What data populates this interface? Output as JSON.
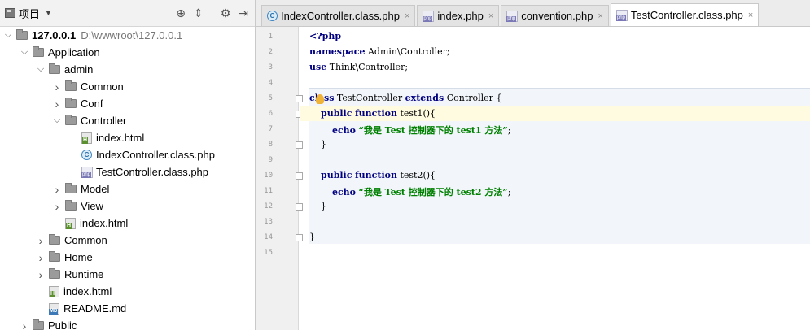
{
  "sidebar": {
    "title": "项目",
    "tree": [
      {
        "label": "127.0.0.1",
        "path": "D:\\wwwroot\\127.0.0.1",
        "type": "folder",
        "depth": 0,
        "expanded": true
      },
      {
        "label": "Application",
        "type": "folder",
        "depth": 1,
        "expanded": true
      },
      {
        "label": "admin",
        "type": "folder",
        "depth": 2,
        "expanded": true
      },
      {
        "label": "Common",
        "type": "folder",
        "depth": 3,
        "expanded": false
      },
      {
        "label": "Conf",
        "type": "folder",
        "depth": 3,
        "expanded": false
      },
      {
        "label": "Controller",
        "type": "folder",
        "depth": 3,
        "expanded": true
      },
      {
        "label": "index.html",
        "type": "html",
        "depth": 4
      },
      {
        "label": "IndexController.class.php",
        "type": "class",
        "depth": 4
      },
      {
        "label": "TestController.class.php",
        "type": "php",
        "depth": 4
      },
      {
        "label": "Model",
        "type": "folder",
        "depth": 3,
        "expanded": false
      },
      {
        "label": "View",
        "type": "folder",
        "depth": 3,
        "expanded": false
      },
      {
        "label": "index.html",
        "type": "html",
        "depth": 3
      },
      {
        "label": "Common",
        "type": "folder",
        "depth": 2,
        "expanded": false
      },
      {
        "label": "Home",
        "type": "folder",
        "depth": 2,
        "expanded": false
      },
      {
        "label": "Runtime",
        "type": "folder",
        "depth": 2,
        "expanded": false
      },
      {
        "label": "index.html",
        "type": "html",
        "depth": 2
      },
      {
        "label": "README.md",
        "type": "md",
        "depth": 2
      },
      {
        "label": "Public",
        "type": "folder",
        "depth": 1,
        "expanded": false
      }
    ]
  },
  "tabs": [
    {
      "label": "IndexController.class.php",
      "icon": "class-icon",
      "active": false
    },
    {
      "label": "index.php",
      "icon": "php-file-icon",
      "active": false
    },
    {
      "label": "convention.php",
      "icon": "php-file-icon",
      "active": false
    },
    {
      "label": "TestController.class.php",
      "icon": "php-file-icon",
      "active": true
    }
  ],
  "code": {
    "lines": [
      {
        "n": "1",
        "text": "<?php"
      },
      {
        "n": "2",
        "text": "namespace Admin\\Controller;"
      },
      {
        "n": "3",
        "text": "use Think\\Controller;"
      },
      {
        "n": "4",
        "text": ""
      },
      {
        "n": "5",
        "text": "class TestController extends Controller {"
      },
      {
        "n": "6",
        "text": "    public function test1(){"
      },
      {
        "n": "7",
        "text": "        echo \"我是 Test 控制器下的 test1 方法\";"
      },
      {
        "n": "8",
        "text": "    }"
      },
      {
        "n": "9",
        "text": ""
      },
      {
        "n": "10",
        "text": "    public function test2(){"
      },
      {
        "n": "11",
        "text": "        echo \"我是 Test 控制器下的 test2 方法\";"
      },
      {
        "n": "12",
        "text": "    }"
      },
      {
        "n": "13",
        "text": ""
      },
      {
        "n": "14",
        "text": "}"
      },
      {
        "n": "15",
        "text": ""
      }
    ]
  },
  "colors": {
    "keyword": "#000080",
    "string": "#008000"
  }
}
